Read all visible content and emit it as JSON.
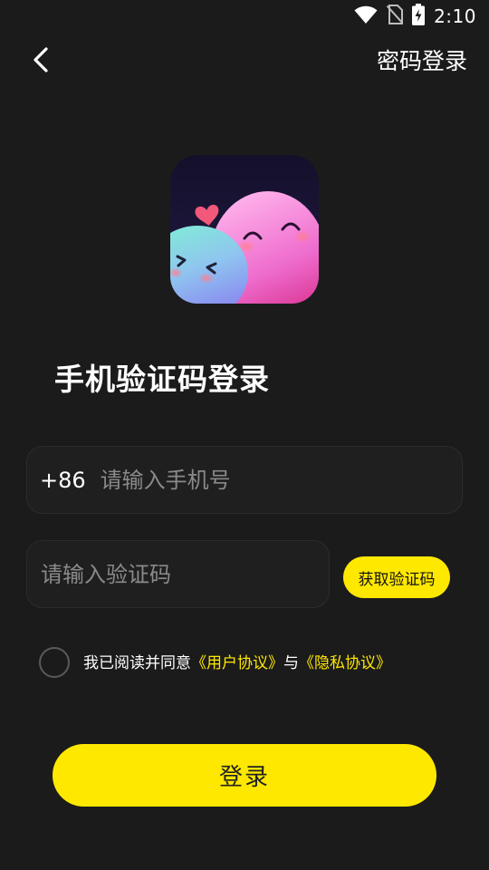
{
  "status_bar": {
    "time": "2:10",
    "icons": [
      "wifi-icon",
      "no-sim-icon",
      "battery-charging-icon"
    ]
  },
  "nav": {
    "back_icon": "chevron-left-icon",
    "password_login_label": "密码登录"
  },
  "app_icon": {
    "name": "app-logo"
  },
  "title": "手机验证码登录",
  "phone": {
    "country_code": "+86",
    "value": "",
    "placeholder": "请输入手机号"
  },
  "code": {
    "value": "",
    "placeholder": "请输入验证码",
    "get_code_label": "获取验证码"
  },
  "agreement": {
    "checked": false,
    "prefix": "我已阅读并同意",
    "user_agreement": "《用户协议》",
    "conjunction": "与",
    "privacy_policy": "《隐私协议》"
  },
  "login_button_label": "登录",
  "colors": {
    "background": "#1b1b1b",
    "accent": "#ffe800",
    "field_bg": "#1f1f1f",
    "placeholder": "#8a8a8a"
  }
}
